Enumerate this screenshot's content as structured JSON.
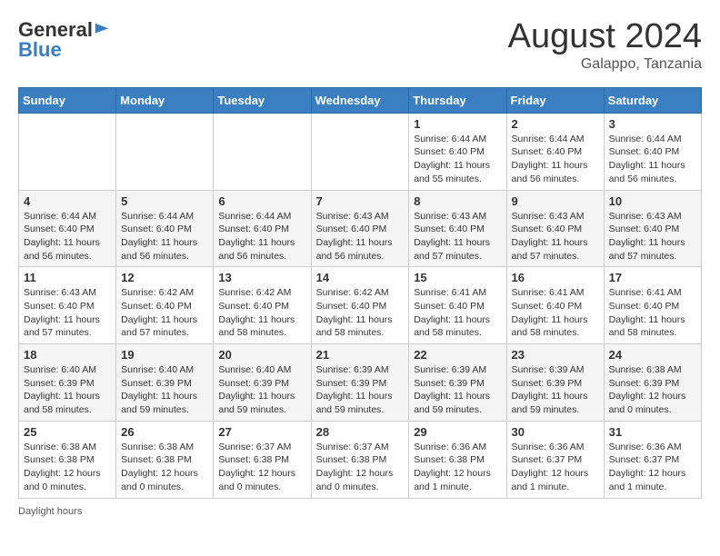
{
  "header": {
    "logo": {
      "general": "General",
      "blue": "Blue"
    },
    "month": "August 2024",
    "location": "Galappo, Tanzania"
  },
  "days_of_week": [
    "Sunday",
    "Monday",
    "Tuesday",
    "Wednesday",
    "Thursday",
    "Friday",
    "Saturday"
  ],
  "weeks": [
    [
      {
        "day": "",
        "info": ""
      },
      {
        "day": "",
        "info": ""
      },
      {
        "day": "",
        "info": ""
      },
      {
        "day": "",
        "info": ""
      },
      {
        "day": "1",
        "info": "Sunrise: 6:44 AM\nSunset: 6:40 PM\nDaylight: 11 hours\nand 55 minutes."
      },
      {
        "day": "2",
        "info": "Sunrise: 6:44 AM\nSunset: 6:40 PM\nDaylight: 11 hours\nand 56 minutes."
      },
      {
        "day": "3",
        "info": "Sunrise: 6:44 AM\nSunset: 6:40 PM\nDaylight: 11 hours\nand 56 minutes."
      }
    ],
    [
      {
        "day": "4",
        "info": "Sunrise: 6:44 AM\nSunset: 6:40 PM\nDaylight: 11 hours\nand 56 minutes."
      },
      {
        "day": "5",
        "info": "Sunrise: 6:44 AM\nSunset: 6:40 PM\nDaylight: 11 hours\nand 56 minutes."
      },
      {
        "day": "6",
        "info": "Sunrise: 6:44 AM\nSunset: 6:40 PM\nDaylight: 11 hours\nand 56 minutes."
      },
      {
        "day": "7",
        "info": "Sunrise: 6:43 AM\nSunset: 6:40 PM\nDaylight: 11 hours\nand 56 minutes."
      },
      {
        "day": "8",
        "info": "Sunrise: 6:43 AM\nSunset: 6:40 PM\nDaylight: 11 hours\nand 57 minutes."
      },
      {
        "day": "9",
        "info": "Sunrise: 6:43 AM\nSunset: 6:40 PM\nDaylight: 11 hours\nand 57 minutes."
      },
      {
        "day": "10",
        "info": "Sunrise: 6:43 AM\nSunset: 6:40 PM\nDaylight: 11 hours\nand 57 minutes."
      }
    ],
    [
      {
        "day": "11",
        "info": "Sunrise: 6:43 AM\nSunset: 6:40 PM\nDaylight: 11 hours\nand 57 minutes."
      },
      {
        "day": "12",
        "info": "Sunrise: 6:42 AM\nSunset: 6:40 PM\nDaylight: 11 hours\nand 57 minutes."
      },
      {
        "day": "13",
        "info": "Sunrise: 6:42 AM\nSunset: 6:40 PM\nDaylight: 11 hours\nand 58 minutes."
      },
      {
        "day": "14",
        "info": "Sunrise: 6:42 AM\nSunset: 6:40 PM\nDaylight: 11 hours\nand 58 minutes."
      },
      {
        "day": "15",
        "info": "Sunrise: 6:41 AM\nSunset: 6:40 PM\nDaylight: 11 hours\nand 58 minutes."
      },
      {
        "day": "16",
        "info": "Sunrise: 6:41 AM\nSunset: 6:40 PM\nDaylight: 11 hours\nand 58 minutes."
      },
      {
        "day": "17",
        "info": "Sunrise: 6:41 AM\nSunset: 6:40 PM\nDaylight: 11 hours\nand 58 minutes."
      }
    ],
    [
      {
        "day": "18",
        "info": "Sunrise: 6:40 AM\nSunset: 6:39 PM\nDaylight: 11 hours\nand 58 minutes."
      },
      {
        "day": "19",
        "info": "Sunrise: 6:40 AM\nSunset: 6:39 PM\nDaylight: 11 hours\nand 59 minutes."
      },
      {
        "day": "20",
        "info": "Sunrise: 6:40 AM\nSunset: 6:39 PM\nDaylight: 11 hours\nand 59 minutes."
      },
      {
        "day": "21",
        "info": "Sunrise: 6:39 AM\nSunset: 6:39 PM\nDaylight: 11 hours\nand 59 minutes."
      },
      {
        "day": "22",
        "info": "Sunrise: 6:39 AM\nSunset: 6:39 PM\nDaylight: 11 hours\nand 59 minutes."
      },
      {
        "day": "23",
        "info": "Sunrise: 6:39 AM\nSunset: 6:39 PM\nDaylight: 11 hours\nand 59 minutes."
      },
      {
        "day": "24",
        "info": "Sunrise: 6:38 AM\nSunset: 6:39 PM\nDaylight: 12 hours\nand 0 minutes."
      }
    ],
    [
      {
        "day": "25",
        "info": "Sunrise: 6:38 AM\nSunset: 6:38 PM\nDaylight: 12 hours\nand 0 minutes."
      },
      {
        "day": "26",
        "info": "Sunrise: 6:38 AM\nSunset: 6:38 PM\nDaylight: 12 hours\nand 0 minutes."
      },
      {
        "day": "27",
        "info": "Sunrise: 6:37 AM\nSunset: 6:38 PM\nDaylight: 12 hours\nand 0 minutes."
      },
      {
        "day": "28",
        "info": "Sunrise: 6:37 AM\nSunset: 6:38 PM\nDaylight: 12 hours\nand 0 minutes."
      },
      {
        "day": "29",
        "info": "Sunrise: 6:36 AM\nSunset: 6:38 PM\nDaylight: 12 hours\nand 1 minute."
      },
      {
        "day": "30",
        "info": "Sunrise: 6:36 AM\nSunset: 6:37 PM\nDaylight: 12 hours\nand 1 minute."
      },
      {
        "day": "31",
        "info": "Sunrise: 6:36 AM\nSunset: 6:37 PM\nDaylight: 12 hours\nand 1 minute."
      }
    ]
  ],
  "footer": {
    "note": "Daylight hours"
  }
}
